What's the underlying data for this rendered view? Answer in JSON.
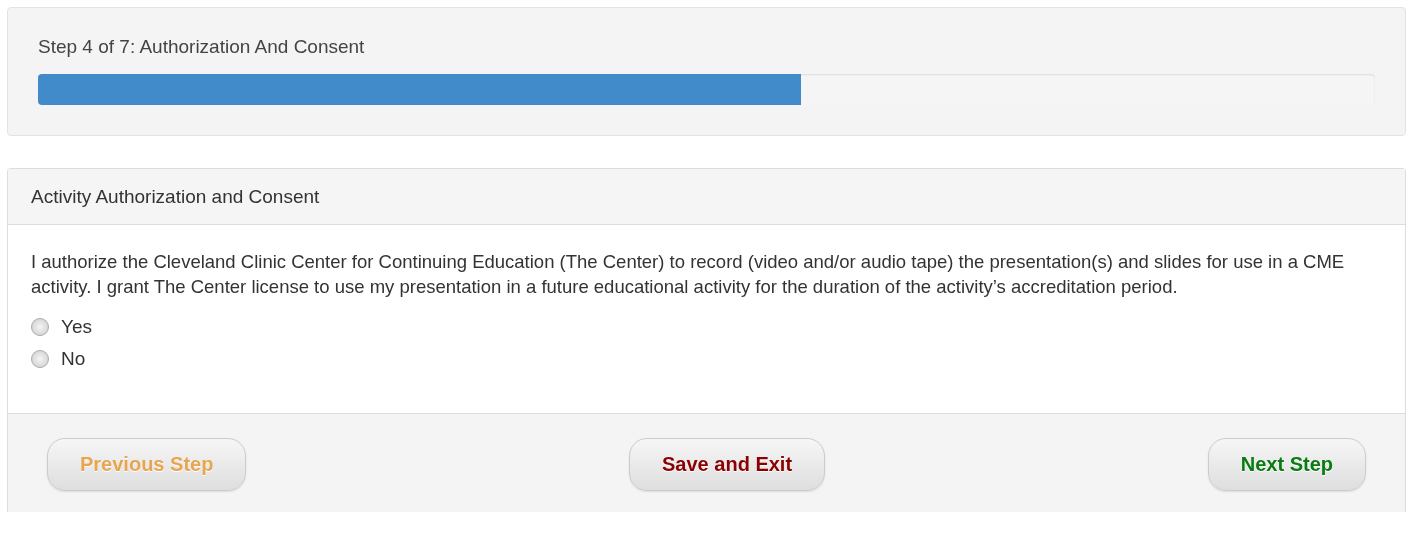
{
  "progress": {
    "label": "Step 4 of 7: Authorization And Consent",
    "level": 0.571
  },
  "section": {
    "title": "Activity Authorization and Consent",
    "statement": "I authorize the Cleveland Clinic Center for Continuing Education (The Center) to record (video and/or audio tape) the presentation(s) and slides for use in a CME activity. I grant The Center license to use my presentation in a future educational activity for the duration of the activity’s accreditation period.",
    "options": [
      {
        "label": "Yes",
        "selected": false
      },
      {
        "label": "No",
        "selected": false
      }
    ]
  },
  "buttons": [
    {
      "label": "Previous Step",
      "color": "#e8a550"
    },
    {
      "label": "Save and Exit",
      "color": "#8b0000"
    },
    {
      "label": "Next Step",
      "color": "#0a7a12"
    }
  ]
}
